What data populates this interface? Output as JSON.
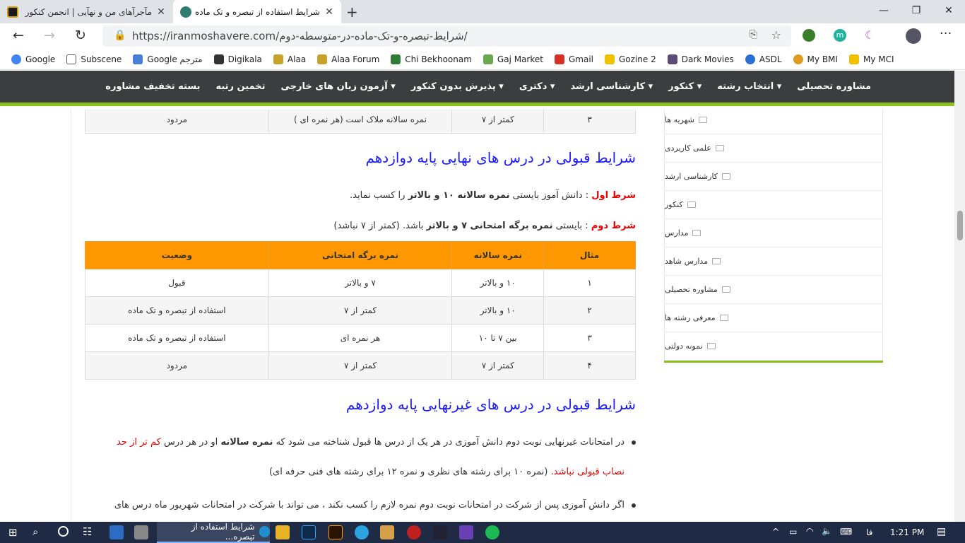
{
  "browser": {
    "tabs": [
      {
        "title": "مآجرآهای من و نهآیی | انجمن کنکور",
        "active": false
      },
      {
        "title": "شرایط استفاده از تبصره و تک ماده",
        "active": true
      }
    ],
    "url": "https://iranmoshavere.com/شرایط-تبصره-و-تک-ماده-در-متوسطه-دوم/",
    "bookmarks": [
      "Google",
      "Subscene",
      "Google مترجم",
      "Digikala",
      "Alaa",
      "Alaa Forum",
      "Chi Bekhoonam",
      "Gaj Market",
      "Gmail",
      "Gozine 2",
      "Dark Movies",
      "ASDL",
      "My BMI",
      "My MCI"
    ],
    "profile_letter": "m"
  },
  "site_nav": [
    "مشاوره تحصیلی",
    "انتخاب رشته",
    "کنکور",
    "کارشناسی ارشد",
    "دکتری",
    "پذیرش بدون کنکور",
    "آزمون زبان های خارجی",
    "تخمین رتبه",
    "بسته تخفیف مشاوره"
  ],
  "top_row": [
    "۳",
    "کمتر از ۷",
    "نمره سالانه ملاک است (هر نمره ای )",
    "مردود"
  ],
  "section1": {
    "heading": "شرایط قبولی در درس های نهایی پایه دوازدهم",
    "cond1_label": "شرط اول",
    "cond1_text_a": " : دانش آموز بایستی ",
    "cond1_bold": "نمره سالانه ۱۰ و بالاتر",
    "cond1_text_b": " را کسب نماید.",
    "cond2_label": "شرط دوم",
    "cond2_text_a": " : بایستی ",
    "cond2_bold": "نمره برگه امتحانی ۷ و بالاتر",
    "cond2_text_b": " باشد. (کمتر از ۷ نباشد)"
  },
  "table": {
    "headers": [
      "مثال",
      "نمره سالانه",
      "نمره برگه امتحانی",
      "وضعیت"
    ],
    "rows": [
      [
        "۱",
        "۱۰ و بالاتر",
        "۷ و بالاتر",
        "قبول"
      ],
      [
        "۲",
        "۱۰ و بالاتر",
        "کمتر از ۷",
        "استفاده از تبصره و تک ماده"
      ],
      [
        "۳",
        "بین ۷ تا ۱۰",
        "هر نمره ای",
        "استفاده از تبصره و تک ماده"
      ],
      [
        "۴",
        "کمتر از ۷",
        "کمتر از ۷",
        "مردود"
      ]
    ]
  },
  "section2": {
    "heading": "شرایط قبولی در درس های غیرنهایی پایه دوازدهم",
    "b1_a": "در امتحانات غیرنهایی نوبت دوم دانش آموزی در هر یک از درس ها قبول شناخته می شود که ",
    "b1_bold": "نمره سالانه",
    "b1_b": " او در هر درس ",
    "b1_red": "کم تر از حد",
    "b1_line2_red": "نصاب قبولی نباشد.",
    "b1_line2": " (نمره ۱۰ برای رشته های نظری و نمره ۱۲ برای رشته های فنی حرفه ای)",
    "b2": "اگر دانش آموزی پس از شرکت در امتحانات نوبت دوم نمره لازم را کسب نکند ، می تواند با شرکت در امتحانات شهریور ماه درس های"
  },
  "sidebar": [
    "شهریه ها",
    "علمی کاربردی",
    "کارشناسی ارشد",
    "کنکور",
    "مدارس",
    "مدارس شاهد",
    "مشاوره تحصیلی",
    "معرفی رشته ها",
    "نمونه دولتی"
  ],
  "taskbar": {
    "active_title": "شرایط استفاده از تبصره...",
    "lang": "فا",
    "time": "1:21 PM"
  }
}
